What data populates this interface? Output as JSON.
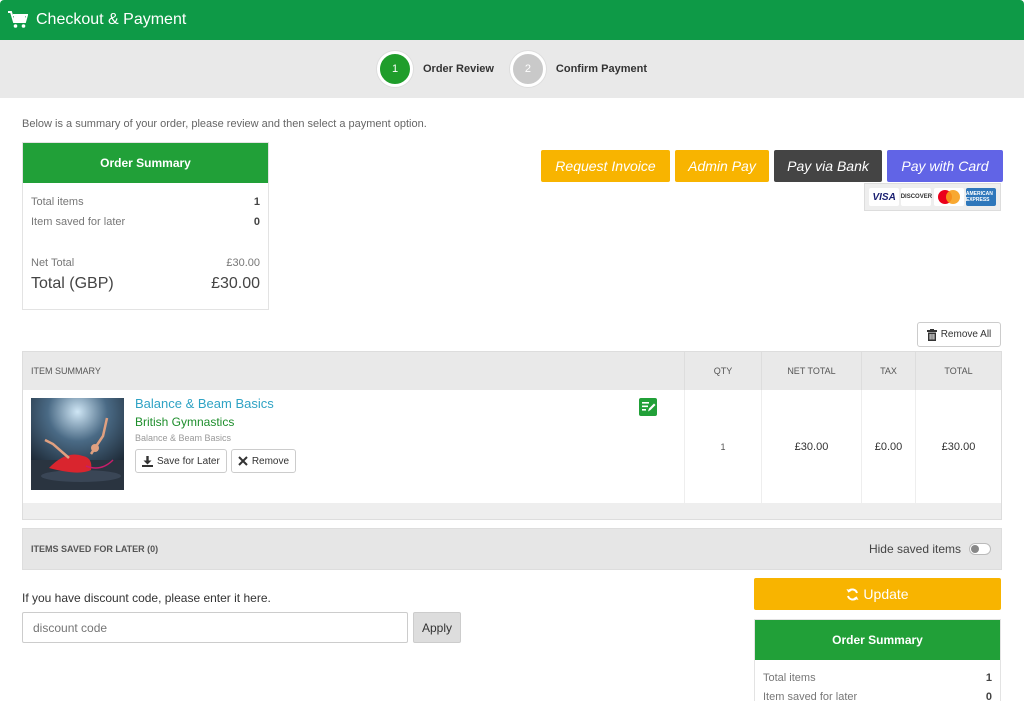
{
  "header": {
    "title": "Checkout & Payment"
  },
  "steps": [
    {
      "num": "1",
      "label": "Order Review"
    },
    {
      "num": "2",
      "label": "Confirm Payment"
    }
  ],
  "intro": "Below is a summary of your order, please review and then select a payment option.",
  "summary": {
    "title": "Order Summary",
    "total_items_label": "Total items",
    "total_items": "1",
    "saved_label": "Item saved for later",
    "saved": "0",
    "net_total_label": "Net Total",
    "net_total": "£30.00",
    "total_label": "Total (GBP)",
    "total": "£30.00"
  },
  "payment": {
    "invoice": "Request Invoice",
    "admin": "Admin Pay",
    "bank": "Pay via Bank",
    "card": "Pay with Card",
    "card_logos": {
      "visa": "VISA",
      "discover": "DISCOVER",
      "amex": "AMERICAN EXPRESS"
    }
  },
  "remove_all": "Remove All",
  "table": {
    "headers": {
      "item": "ITEM SUMMARY",
      "qty": "QTY",
      "net": "NET TOTAL",
      "tax": "TAX",
      "total": "TOTAL"
    },
    "row": {
      "title": "Balance & Beam Basics",
      "org": "British Gymnastics",
      "subtitle": "Balance & Beam Basics",
      "save_later": "Save for Later",
      "remove": "Remove",
      "qty": "1",
      "net": "£30.00",
      "tax": "£0.00",
      "total": "£30.00"
    }
  },
  "saved_items": {
    "label": "ITEMS SAVED FOR LATER (0)",
    "hide": "Hide saved items"
  },
  "discount": {
    "label": "If you have discount code, please enter it here.",
    "placeholder": "discount code",
    "apply": "Apply"
  },
  "update": "Update",
  "summary2": {
    "title": "Order Summary",
    "total_items_label": "Total items",
    "total_items": "1",
    "saved_label": "Item saved for later",
    "saved": "0"
  },
  "colors": {
    "brand_green": "#0e9a47",
    "accent_yellow": "#f8b400",
    "card_purple": "#6164e6",
    "bank_dark": "#444444"
  }
}
